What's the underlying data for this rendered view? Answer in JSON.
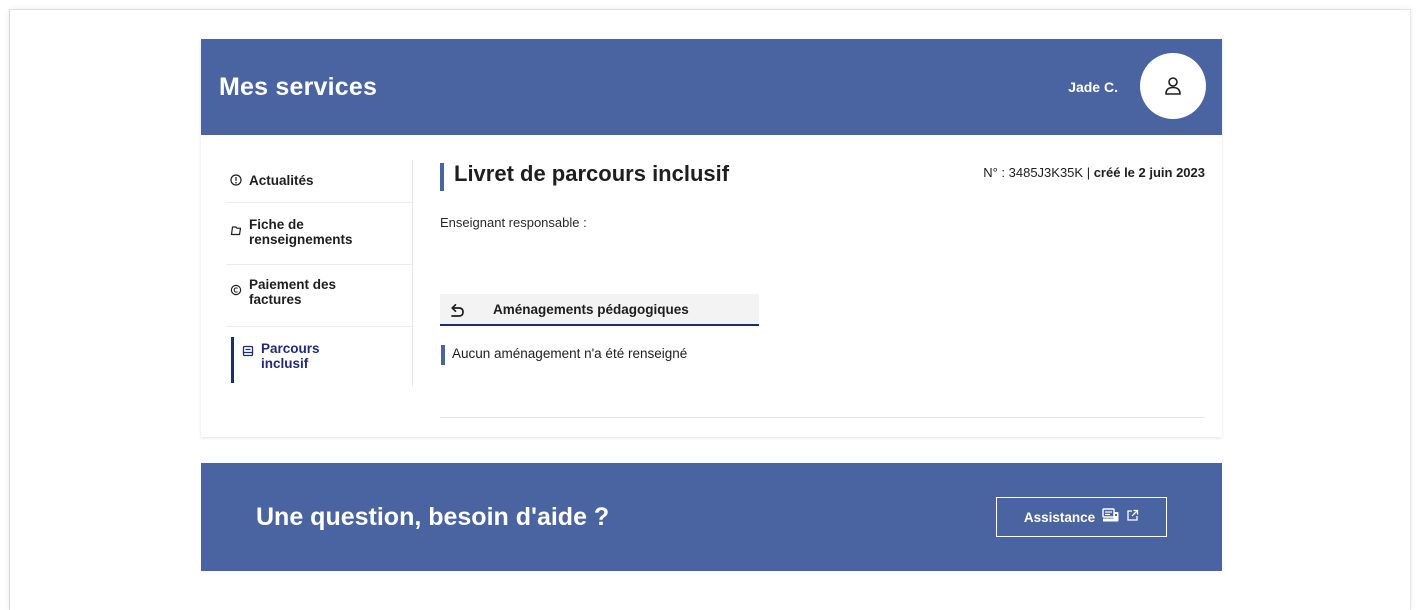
{
  "header": {
    "title": "Mes services",
    "user_name": "Jade C."
  },
  "sidebar": {
    "items": [
      {
        "label": "Actualités",
        "icon": "info-icon"
      },
      {
        "label_line1": "Fiche de",
        "label_line2": "renseignements",
        "icon": "folder-icon"
      },
      {
        "label_line1": "Paiement des",
        "label_line2": "factures",
        "icon": "coin-icon"
      },
      {
        "label_line1": "Parcours",
        "label_line2": "inclusif",
        "icon": "booklet-icon",
        "active": true
      }
    ]
  },
  "main": {
    "title": "Livret de parcours inclusif",
    "doc_number": "N° : 3485J3K35K |",
    "doc_created": "créé le 2 juin 2023",
    "teacher_label": "Enseignant responsable :",
    "tab_label": "Aménagements pédagogiques",
    "notice": "Aucun aménagement n'a été renseigné"
  },
  "help": {
    "question": "Une question, besoin d'aide ?",
    "button_label": "Assistance"
  },
  "colors": {
    "primary": "#4a64a2",
    "active": "#1f2b78"
  }
}
